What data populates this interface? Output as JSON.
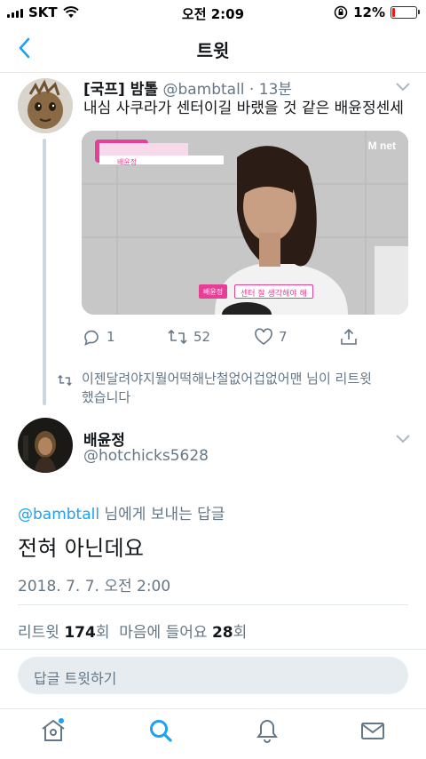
{
  "status_bar": {
    "carrier": "SKT",
    "time": "오전 2:09",
    "battery": "12%",
    "battery_level": 0.12,
    "battery_color": "#e02020"
  },
  "header": {
    "title": "트윗"
  },
  "quoted_tweet": {
    "name": "[국프] 밤톨",
    "handle": "@bambtall",
    "time": "13분",
    "text": "내심 사쿠라가 센터이길 바랬을 것 같은 배윤정센세",
    "media": {
      "logo": "M net",
      "badge_label": "배윤정",
      "caption_name": "배윤정",
      "caption_text": "센터 잘 생각해야 해"
    },
    "replies": "1",
    "retweets": "52",
    "likes": "7"
  },
  "retweet_note": "이젠달려야지뭘어떡해난철없어겁없어맨 님이 리트윗했습니다",
  "tweet": {
    "name": "배윤정",
    "handle": "@hotchicks5628",
    "reply_to_handle": "@bambtall",
    "reply_to_suffix": " 님에게 보내는 답글",
    "text": "전혀 아닌데요",
    "timestamp": "2018. 7. 7. 오전 2:00",
    "retweet_label": "리트윗",
    "retweet_count": "174",
    "retweet_unit": "회",
    "like_label": "마음에 들어요",
    "like_count": "28",
    "like_unit": "회"
  },
  "reply_box": {
    "placeholder": "답글 트윗하기"
  },
  "accent": "#1da1f2"
}
